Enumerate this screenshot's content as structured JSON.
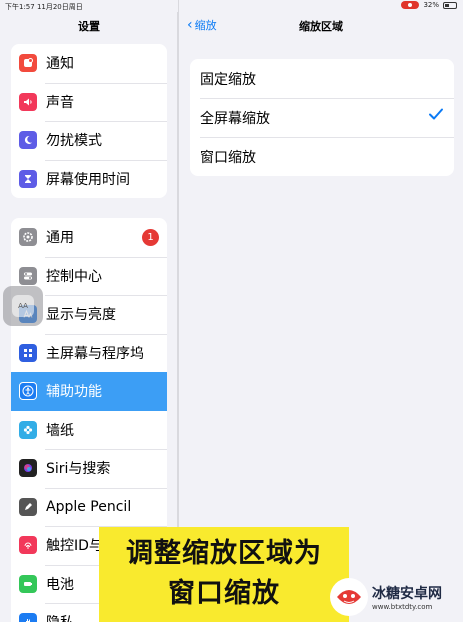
{
  "status_bar": {
    "time": "下午1:57  11月20日周日",
    "battery": "32%"
  },
  "sidebar": {
    "title": "设置",
    "group1": [
      {
        "label": "通知",
        "icon": "bell-icon",
        "color": "#f24a3d"
      },
      {
        "label": "声音",
        "icon": "speaker-icon",
        "color": "#f2385a"
      },
      {
        "label": "勿扰模式",
        "icon": "moon-icon",
        "color": "#5e5ce6"
      },
      {
        "label": "屏幕使用时间",
        "icon": "hourglass-icon",
        "color": "#5e5ce6"
      }
    ],
    "group2": [
      {
        "label": "通用",
        "icon": "gear-icon",
        "color": "#8e8e93",
        "badge": "1"
      },
      {
        "label": "控制中心",
        "icon": "toggles-icon",
        "color": "#8e8e93"
      },
      {
        "label": "显示与亮度",
        "icon": "aa-icon",
        "color": "#1c7cf2"
      },
      {
        "label": "主屏幕与程序坞",
        "icon": "grid-icon",
        "color": "#2f5fe0"
      },
      {
        "label": "辅助功能",
        "icon": "accessibility-icon",
        "color": "#1c7cf2",
        "selected": true
      },
      {
        "label": "墙纸",
        "icon": "flower-icon",
        "color": "#32ade6"
      },
      {
        "label": "Siri与搜索",
        "icon": "siri-icon",
        "color": "#222222"
      },
      {
        "label": "Apple Pencil",
        "icon": "pencil-icon",
        "color": "#555555"
      },
      {
        "label": "触控ID与",
        "icon": "fingerprint-icon",
        "color": "#f2385a"
      },
      {
        "label": "电池",
        "icon": "battery-icon",
        "color": "#34c759"
      },
      {
        "label": "隐私",
        "icon": "hand-icon",
        "color": "#1c7cf2"
      }
    ]
  },
  "detail": {
    "back_label": "缩放",
    "title": "缩放区域",
    "options": [
      {
        "label": "固定缩放",
        "checked": false
      },
      {
        "label": "全屏幕缩放",
        "checked": true
      },
      {
        "label": "窗口缩放",
        "checked": false
      }
    ]
  },
  "floating_control": {
    "label": "AA"
  },
  "caption": {
    "line1": "调整缩放区域为",
    "line2": "窗口缩放"
  },
  "watermark": {
    "name": "冰糖安卓网",
    "url": "www.btxtdty.com"
  },
  "colors": {
    "accent": "#0a7af5",
    "selected_row": "#3c9ef5",
    "caption_bg": "#f9ea2e"
  }
}
